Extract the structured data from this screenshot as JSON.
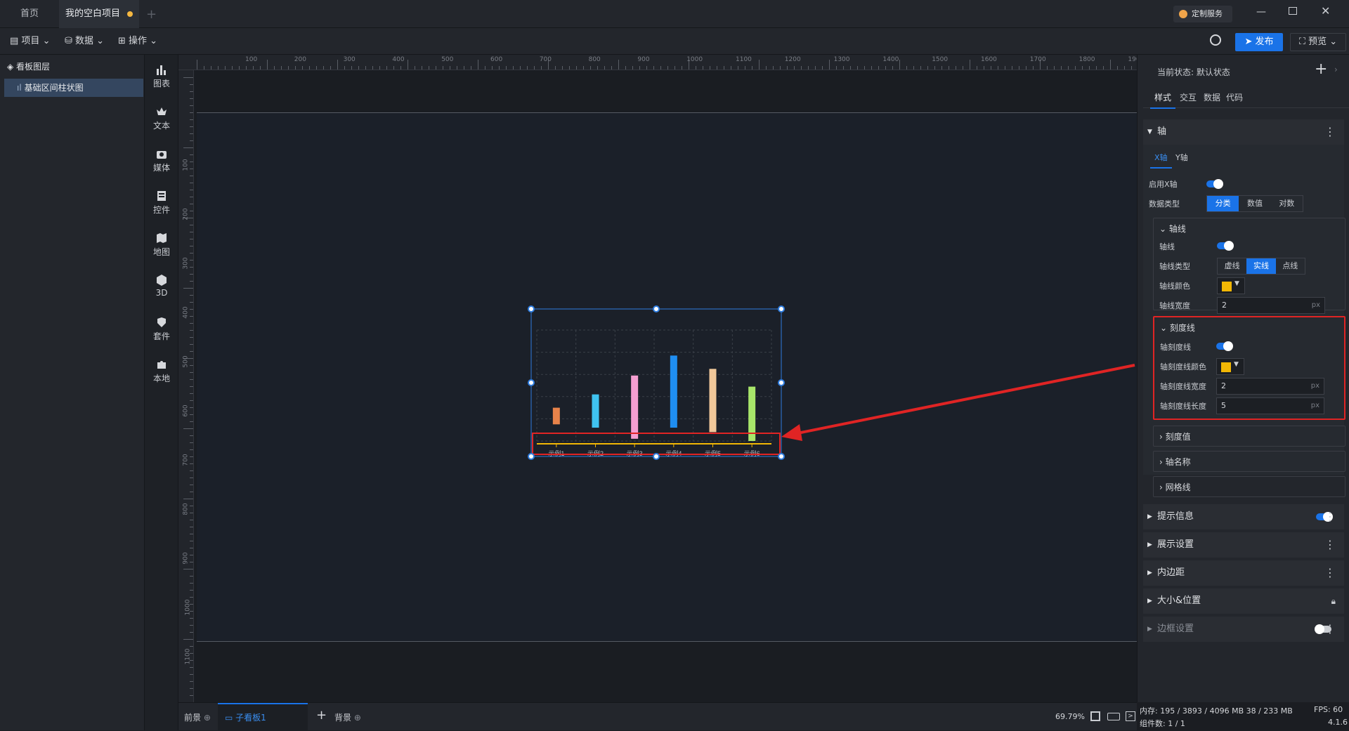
{
  "tabs": [
    {
      "label": "首页"
    },
    {
      "label": "我的空白项目"
    }
  ],
  "service_label": "定制服务",
  "toolbar": {
    "project": "项目",
    "data": "数据",
    "operate": "操作",
    "publish": "发布",
    "preview": "预览"
  },
  "layers": {
    "title": "看板图层",
    "items": [
      {
        "label": "基础区间柱状图"
      }
    ]
  },
  "iconbar": [
    {
      "label": "图表",
      "icon": "bar-chart-icon"
    },
    {
      "label": "文本",
      "icon": "text-icon"
    },
    {
      "label": "媒体",
      "icon": "media-icon"
    },
    {
      "label": "控件",
      "icon": "widget-icon"
    },
    {
      "label": "地图",
      "icon": "map-icon"
    },
    {
      "label": "3D",
      "icon": "cube-icon"
    },
    {
      "label": "套件",
      "icon": "kit-icon"
    },
    {
      "label": "本地",
      "icon": "puzzle-icon"
    }
  ],
  "ruler": {
    "top": [
      "100",
      "200",
      "300",
      "400",
      "500",
      "600",
      "700",
      "800",
      "900",
      "1000",
      "1100",
      "1200",
      "1300",
      "1400",
      "1500",
      "1600",
      "1700",
      "1800",
      "1900"
    ],
    "left": [
      "100",
      "200",
      "300",
      "400",
      "500",
      "600",
      "700",
      "800",
      "900",
      "1000",
      "1100"
    ]
  },
  "chart_data": {
    "type": "bar",
    "categories": [
      "示例1",
      "示例2",
      "示例3",
      "示例4",
      "示例5",
      "示例6"
    ],
    "series": [
      {
        "low": [
          15,
          12,
          2,
          12,
          8,
          0
        ],
        "high": [
          30,
          42,
          59,
          77,
          65,
          49
        ]
      }
    ],
    "colors": [
      "#e8834a",
      "#3fc3f0",
      "#f59ed1",
      "#1f8ef1",
      "#f1c89a",
      "#a8e66a"
    ],
    "axis_line_color": "#f2b705",
    "ylim": [
      0,
      100
    ],
    "grid": true
  },
  "bottom": {
    "front": "前景",
    "subboard": "子看板1",
    "background": "背景",
    "zoom": "69.79%"
  },
  "panel": {
    "state_label": "当前状态:",
    "state_value": "默认状态",
    "tabs": [
      "样式",
      "交互",
      "数据",
      "代码"
    ],
    "axis_section": "轴",
    "axis_tabs": [
      "X轴",
      "Y轴"
    ],
    "enable_x": "启用X轴",
    "data_type": "数据类型",
    "data_type_options": [
      "分类",
      "数值",
      "对数"
    ],
    "axis_line_group": "轴线",
    "axis_line": "轴线",
    "axis_line_type": "轴线类型",
    "axis_line_type_options": [
      "虚线",
      "实线",
      "点线"
    ],
    "axis_line_color": "轴线颜色",
    "axis_line_width": "轴线宽度",
    "axis_line_width_value": "2",
    "tick_group": "刻度线",
    "tick_line": "轴刻度线",
    "tick_color": "轴刻度线颜色",
    "tick_width": "轴刻度线宽度",
    "tick_width_value": "2",
    "tick_length": "轴刻度线长度",
    "tick_length_value": "5",
    "tick_value": "刻度值",
    "axis_name": "轴名称",
    "grid_line": "网格线",
    "tooltip": "提示信息",
    "display": "展示设置",
    "padding": "内边距",
    "size_pos": "大小&位置",
    "border": "边框设置",
    "unit": "px"
  },
  "status": {
    "memory": "内存: 195 / 3893 / 4096 MB 38 / 233 MB",
    "fps": "FPS: 60",
    "components": "组件数: 1 / 1",
    "version": "4.1.6"
  }
}
